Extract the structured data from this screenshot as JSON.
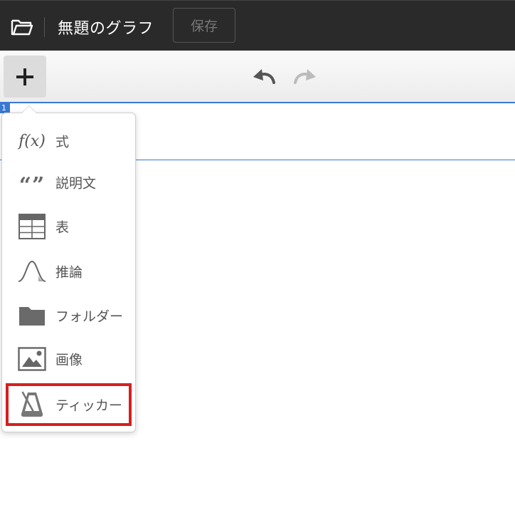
{
  "header": {
    "graph_title": "無題のグラフ",
    "save_label": "保存"
  },
  "expression": {
    "index": "1"
  },
  "add_menu": {
    "items": [
      {
        "id": "expression",
        "label": "式",
        "icon": "fx-icon"
      },
      {
        "id": "note",
        "label": "説明文",
        "icon": "quote-icon"
      },
      {
        "id": "table",
        "label": "表",
        "icon": "table-icon"
      },
      {
        "id": "inference",
        "label": "推論",
        "icon": "distribution-curve-icon"
      },
      {
        "id": "folder",
        "label": "フォルダー",
        "icon": "folder-icon"
      },
      {
        "id": "image",
        "label": "画像",
        "icon": "image-icon"
      },
      {
        "id": "ticker",
        "label": "ティッカー",
        "icon": "metronome-icon"
      }
    ],
    "fx_symbol": "f(x)",
    "quote_symbol": "“”",
    "highlighted_item": "ticker"
  },
  "colors": {
    "topbar": "#2a2a2a",
    "accent_blue": "#3a78d4",
    "highlight_red": "#d61f1f",
    "icon_gray": "#777777"
  }
}
